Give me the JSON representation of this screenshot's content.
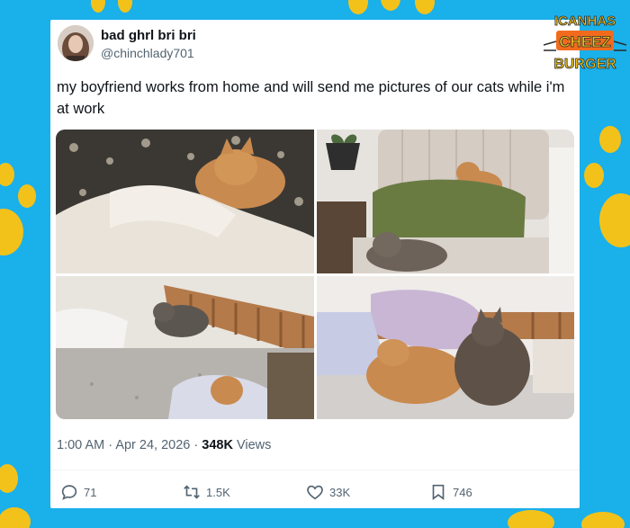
{
  "tweet": {
    "display_name": "bad ghrl bri bri",
    "handle": "@chinchlady701",
    "text": "my boyfriend works from home and will send me pictures of our cats while i'm at work",
    "time": "1:00 AM",
    "separator": "·",
    "date": "Apr 24, 2026",
    "views_count": "348K",
    "views_label": "Views"
  },
  "actions": {
    "replies": "71",
    "retweets": "1.5K",
    "likes": "33K",
    "bookmarks": "746"
  },
  "watermark": {
    "line1": "ICANHAS",
    "line2": "CHEEZ",
    "line3": "BURGER"
  },
  "photos": [
    {
      "name": "photo-cat-under-blanket"
    },
    {
      "name": "photo-cats-on-pillow"
    },
    {
      "name": "photo-cats-on-bed"
    },
    {
      "name": "photo-two-cats-cuddling"
    }
  ],
  "colors": {
    "background": "#1ab0ea",
    "paw": "#f3c21a",
    "text_primary": "#0f1419",
    "text_secondary": "#536471",
    "logo_orange": "#f26b1d"
  }
}
